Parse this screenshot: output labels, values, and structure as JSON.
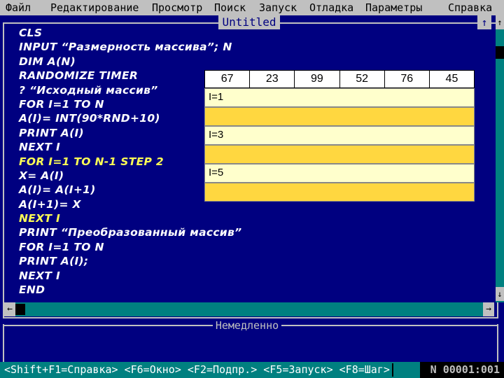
{
  "menu": {
    "items": [
      "Файл",
      "Редактирование",
      "Просмотр",
      "Поиск",
      "Запуск",
      "Отладка",
      "Параметры"
    ],
    "help": "Справка"
  },
  "editor": {
    "title": "Untitled",
    "max_glyph": "↑",
    "scroll_up": "↑",
    "scroll_down": "↓",
    "scroll_left": "←",
    "scroll_right": "→"
  },
  "code": [
    {
      "text": "CLS",
      "highlight": false
    },
    {
      "text": "INPUT “Размерность массива”; N",
      "highlight": false
    },
    {
      "text": "DIM A(N)",
      "highlight": false
    },
    {
      "text": "RANDOMIZE TIMER",
      "highlight": false
    },
    {
      "text": "? “Исходный массив”",
      "highlight": false
    },
    {
      "text": "FOR  I=1 TO N",
      "highlight": false
    },
    {
      "text": "A(I)= INT(90*RND+10)",
      "highlight": false
    },
    {
      "text": "PRINT A(I)",
      "highlight": false
    },
    {
      "text": "NEXT I",
      "highlight": false
    },
    {
      "text": "FOR  I=1 TO N-1 STEP 2",
      "highlight": true
    },
    {
      "text": "X= A(I)",
      "highlight": false
    },
    {
      "text": "A(I)= A(I+1)",
      "highlight": false
    },
    {
      "text": "A(I+1)= X",
      "highlight": false
    },
    {
      "text": "NEXT I",
      "highlight": true
    },
    {
      "text": "PRINT “Преобразованный массив”",
      "highlight": false
    },
    {
      "text": "FOR  I=1 TO N",
      "highlight": false
    },
    {
      "text": "PRINT A(I);",
      "highlight": false
    },
    {
      "text": "NEXT I",
      "highlight": false
    },
    {
      "text": "END",
      "highlight": false
    }
  ],
  "array": {
    "values": [
      "67",
      "23",
      "99",
      "52",
      "76",
      "45"
    ],
    "steps": [
      "I=1",
      "",
      "I=3",
      "",
      "I=5",
      ""
    ]
  },
  "immediate": {
    "title": "Немедленно"
  },
  "status": {
    "keys": "<Shift+F1=Справка> <F6=Окно> <F2=Подпр.> <F5=Запуск> <F8=Шаг>",
    "position": "N 00001:001"
  }
}
